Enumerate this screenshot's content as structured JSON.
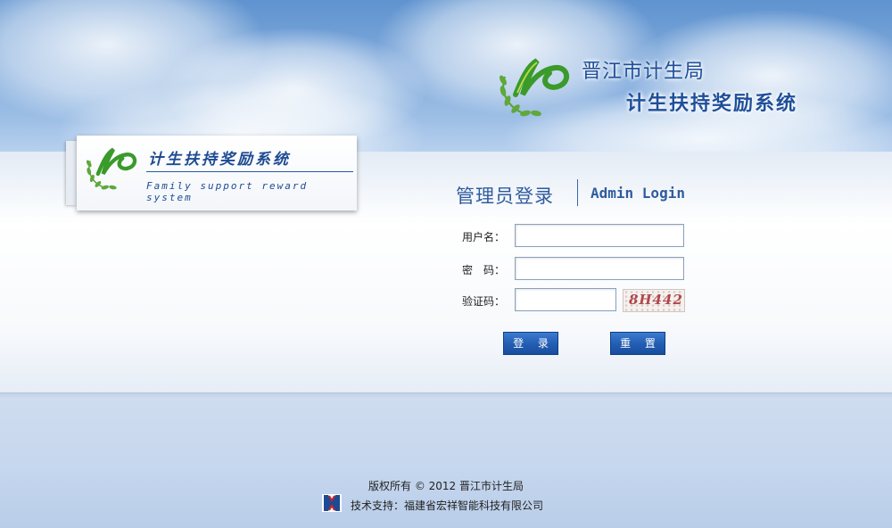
{
  "header": {
    "org_name": "晋江市计生局",
    "system_name": "计生扶持奖励系统"
  },
  "card": {
    "title": "计生扶持奖励系统",
    "subtitle": "Family support reward system"
  },
  "login": {
    "title_cn": "管理员登录",
    "title_en": "Admin Login",
    "username_label": "用户名：",
    "password_label": "密　码：",
    "captcha_label": "验证码：",
    "username_value": "",
    "password_value": "",
    "captcha_value": "",
    "captcha_text": "8H442",
    "login_button": "登 录",
    "reset_button": "重 置"
  },
  "footer": {
    "copyright": "版权所有 © 2012 晋江市计生局",
    "support": "技术支持：福建省宏祥智能科技有限公司"
  },
  "icons": {
    "brand_logo": "leaf-wreath-logo-icon",
    "vendor_logo": "vendor-logo-icon"
  },
  "colors": {
    "brand_blue": "#1f4f9a",
    "logo_green": "#3e9a2a",
    "button_blue": "#245fb4"
  }
}
